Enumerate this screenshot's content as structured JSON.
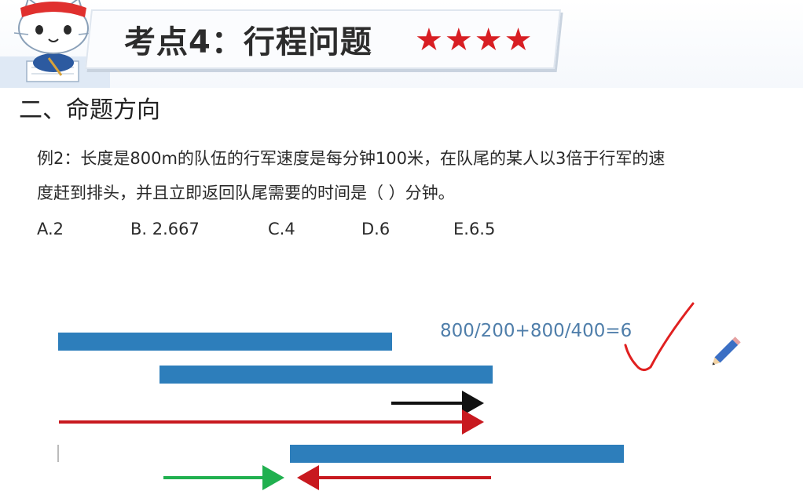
{
  "header": {
    "title": "考点4：行程问题",
    "stars": "★★★★"
  },
  "section": {
    "heading": "二、命题方向"
  },
  "question": {
    "line1": "例2：长度是800m的队伍的行军速度是每分钟100米，在队尾的某人以3倍于行军的速",
    "line2": "度赶到排头，并且立即返回队尾需要的时间是（    ）分钟。"
  },
  "options": {
    "a": "A.2",
    "b": "B. 2.667",
    "c": "C.4",
    "d": "D.6",
    "e": "E.6.5"
  },
  "annotation": {
    "formula": "800/200+800/400=6"
  },
  "colors": {
    "bar_blue": "#2d7ebb",
    "arrow_red": "#c8191f",
    "arrow_black": "#111111",
    "arrow_green": "#20b04f",
    "star_red": "#d81e23",
    "formula_blue": "#4f7eaa",
    "check_red": "#e02020"
  },
  "icons": {
    "mascot": "cat-mascot-icon",
    "pencil": "pencil-icon",
    "check": "checkmark-icon"
  }
}
